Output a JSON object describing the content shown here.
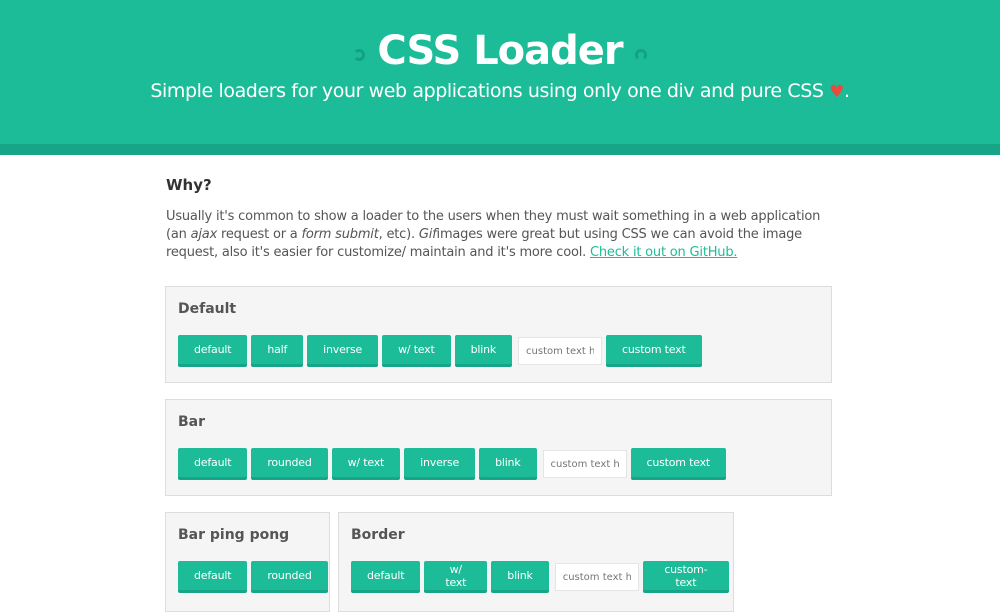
{
  "header": {
    "title": "CSS Loader",
    "subtitle": "Simple loaders for your web applications using only one div and pure CSS",
    "heart": "♥",
    "period": ".",
    "accent_color": "#1dbc98"
  },
  "intro": {
    "heading": "Why?",
    "p1": "Usually it's common to show a loader to the users when they must wait something in a web application (an ",
    "ajax": "ajax",
    "p2": " request or a ",
    "form_submit": "form submit",
    "p3": ", etc). ",
    "gif": "Gif",
    "p4": "images were great but using CSS we can avoid the image request, also it's easier for customize/ maintain and it's more cool. ",
    "link": "Check it out on GitHub."
  },
  "sections": {
    "default": {
      "title": "Default",
      "buttons": [
        "default",
        "half",
        "inverse",
        "w/ text",
        "blink"
      ],
      "input_placeholder": "custom text here",
      "custom_button": "custom text"
    },
    "bar": {
      "title": "Bar",
      "buttons": [
        "default",
        "rounded",
        "w/ text",
        "inverse",
        "blink"
      ],
      "input_placeholder": "custom text here",
      "custom_button": "custom text"
    },
    "bar_ping_pong": {
      "title": "Bar ping pong",
      "buttons": [
        "default",
        "rounded"
      ]
    },
    "border": {
      "title": "Border",
      "buttons": [
        "default",
        "w/ text",
        "blink"
      ],
      "input_placeholder": "custom text here",
      "custom_button": "custom-text"
    }
  }
}
